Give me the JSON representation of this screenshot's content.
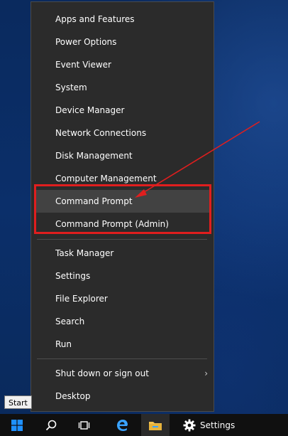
{
  "menu": {
    "items_group1": [
      "Apps and Features",
      "Power Options",
      "Event Viewer",
      "System",
      "Device Manager",
      "Network Connections",
      "Disk Management",
      "Computer Management",
      "Command Prompt",
      "Command Prompt (Admin)"
    ],
    "items_group2": [
      "Task Manager",
      "Settings",
      "File Explorer",
      "Search",
      "Run"
    ],
    "items_group3": [
      "Shut down or sign out",
      "Desktop"
    ],
    "submenu_chevron": "›"
  },
  "taskbar": {
    "start_tooltip": "Start",
    "settings_label": "Settings"
  },
  "colors": {
    "menu_bg": "#2b2b2b",
    "highlight": "#e01e1e",
    "hover": "#424242",
    "taskbar_bg": "#101010",
    "windows_blue": "#1e90ff",
    "edge_blue": "#3aa3ff",
    "explorer_yellow": "#f2c14e"
  },
  "icons": {
    "start": "windows-logo-icon",
    "search": "search-icon",
    "task_view": "task-view-icon",
    "edge": "edge-icon",
    "explorer": "file-explorer-icon",
    "settings": "gear-icon"
  }
}
